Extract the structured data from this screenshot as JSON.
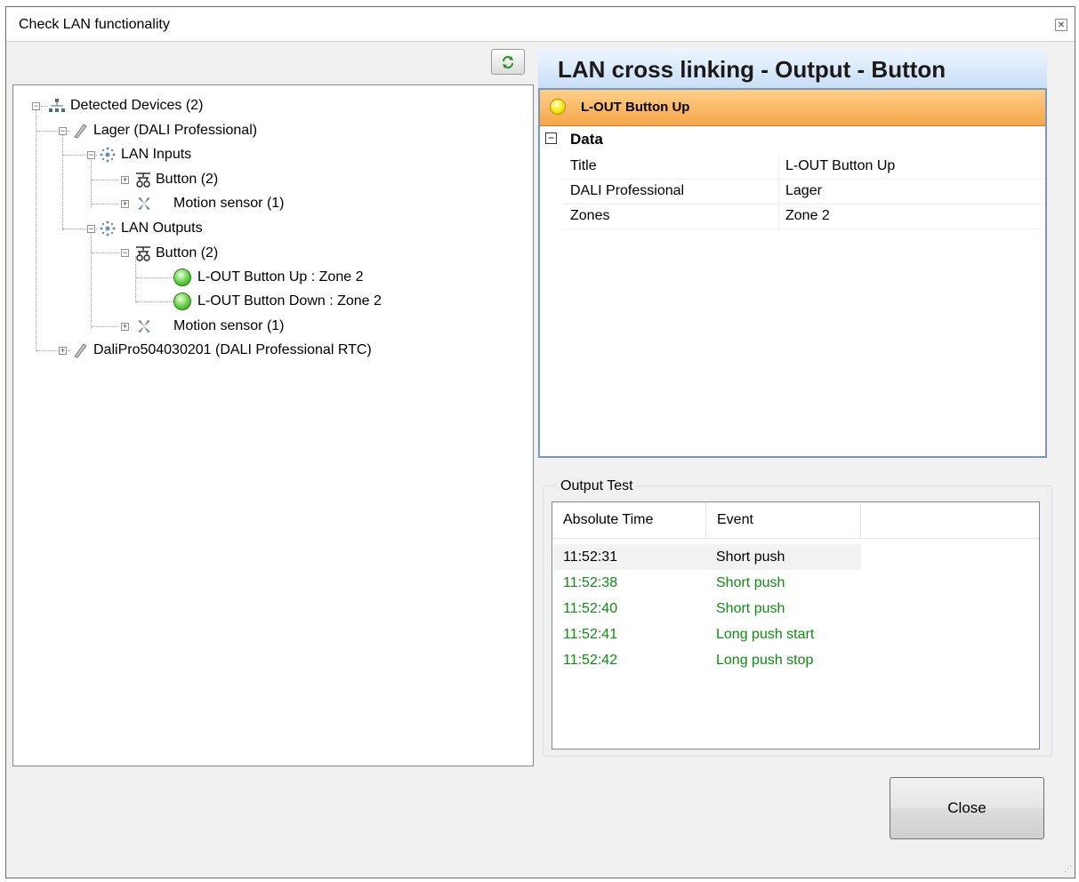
{
  "window": {
    "title": "Check LAN functionality"
  },
  "tree": {
    "root": "Detected Devices (2)",
    "device1": "Lager (DALI Professional)",
    "lan_inputs": "LAN Inputs",
    "inputs_button": "Button (2)",
    "inputs_motion": "Motion sensor (1)",
    "lan_outputs": "LAN Outputs",
    "outputs_button": "Button (2)",
    "out_up": "L-OUT Button Up : Zone 2",
    "out_down": "L-OUT Button Down : Zone 2",
    "outputs_motion": "Motion sensor (1)",
    "device2": "DaliPro504030201 (DALI Professional RTC)"
  },
  "details": {
    "header": "LAN cross linking - Output - Button",
    "selected": "L-OUT Button Up",
    "category": "Data",
    "properties": [
      {
        "name": "Title",
        "value": "L-OUT Button Up"
      },
      {
        "name": "DALI Professional",
        "value": "Lager"
      },
      {
        "name": "Zones",
        "value": "Zone 2"
      }
    ]
  },
  "output_test": {
    "label": "Output Test",
    "columns": [
      "Absolute Time",
      "Event"
    ],
    "rows": [
      {
        "time": "11:52:31",
        "event": "Short push",
        "color": "#000000"
      },
      {
        "time": "11:52:38",
        "event": "Short push",
        "color": "#0f8a12"
      },
      {
        "time": "11:52:40",
        "event": "Short push",
        "color": "#0f8a12"
      },
      {
        "time": "11:52:41",
        "event": "Long push start",
        "color": "#0f8a12"
      },
      {
        "time": "11:52:42",
        "event": "Long push stop",
        "color": "#0f8a12"
      }
    ]
  },
  "buttons": {
    "close": "Close"
  },
  "icons": {
    "refresh": "refresh-icon",
    "network": "network-icon",
    "device": "dali-device-icon",
    "lan": "lan-icon",
    "button": "button-icon",
    "motion": "motion-sensor-icon",
    "status": "green-status-icon"
  }
}
